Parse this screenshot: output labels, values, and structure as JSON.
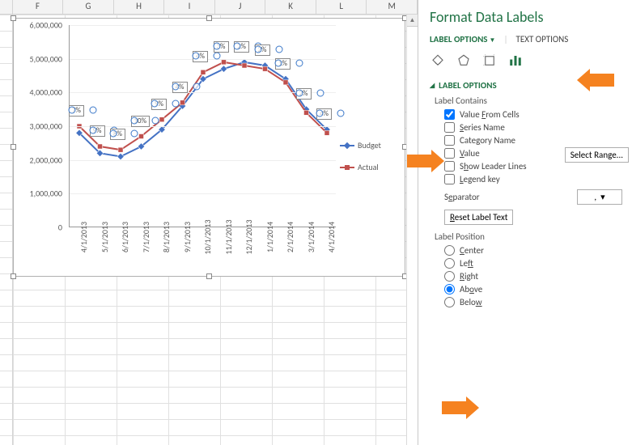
{
  "columns": [
    "F",
    "G",
    "H",
    "I",
    "J",
    "K",
    "L",
    "M"
  ],
  "pane": {
    "title": "Format Data Labels",
    "tabs": {
      "labelOptions": "LABEL OPTIONS",
      "textOptions": "TEXT OPTIONS"
    },
    "activeTab": "labelOptions",
    "section": "LABEL OPTIONS",
    "labelContains": "Label Contains",
    "checks": {
      "valueFromCells": "Value From Cells",
      "seriesName": "Series Name",
      "categoryName": "Category Name",
      "value": "Value",
      "showLeaderLines": "Show Leader Lines",
      "legendKey": "Legend key"
    },
    "checked": {
      "valueFromCells": true,
      "seriesName": false,
      "categoryName": false,
      "value": false,
      "showLeaderLines": false,
      "legendKey": false
    },
    "selectRange": "Select Range...",
    "separatorLabel": "Separator",
    "separatorValue": ",",
    "resetLabel": "Reset Label Text",
    "labelPosition": "Label Position",
    "positions": {
      "center": "Center",
      "left": "Left",
      "right": "Right",
      "above": "Above",
      "below": "Below"
    },
    "positionSelected": "above"
  },
  "chart_data": {
    "type": "line",
    "x": [
      "4/1/2013",
      "5/1/2013",
      "6/1/2013",
      "7/1/2013",
      "8/1/2013",
      "9/1/2013",
      "10/1/2013",
      "11/1/2013",
      "12/1/2013",
      "1/1/2014",
      "2/1/2014",
      "3/1/2014",
      "4/1/2014"
    ],
    "series": [
      {
        "name": "Budget",
        "color": "#4472c4",
        "marker": "diamond",
        "values": [
          2800000,
          2200000,
          2100000,
          2400000,
          2900000,
          3600000,
          4400000,
          4700000,
          4900000,
          4800000,
          4400000,
          3500000,
          2900000
        ]
      },
      {
        "name": "Actual",
        "color": "#c0504d",
        "marker": "square",
        "values": [
          3000000,
          2400000,
          2300000,
          2700000,
          3200000,
          3700000,
          4600000,
          4900000,
          4800000,
          4700000,
          4300000,
          3400000,
          2800000
        ]
      }
    ],
    "data_labels": [
      "7%",
      "9%",
      "8%",
      "10%",
      "9%",
      "4%",
      "4%",
      "3%",
      "2%",
      "2%",
      "1%",
      "2%",
      "4%"
    ],
    "ylim": [
      0,
      6000000
    ],
    "yticks": [
      0,
      1000000,
      2000000,
      3000000,
      4000000,
      5000000,
      6000000
    ],
    "ytick_labels": [
      "0",
      "1,000,000",
      "2,000,000",
      "3,000,000",
      "4,000,000",
      "5,000,000",
      "6,000,000"
    ],
    "legend_position": "right",
    "title": "",
    "xlabel": "",
    "ylabel": ""
  }
}
